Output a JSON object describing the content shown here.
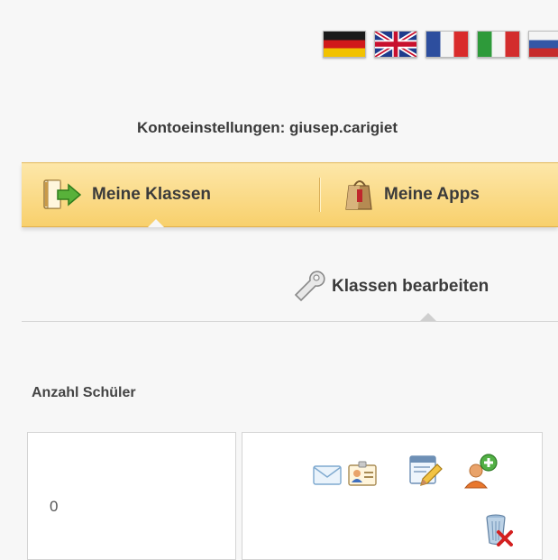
{
  "languages": [
    {
      "code": "de",
      "icon": "flag-germany-icon"
    },
    {
      "code": "en",
      "icon": "flag-uk-icon"
    },
    {
      "code": "fr",
      "icon": "flag-france-icon"
    },
    {
      "code": "it",
      "icon": "flag-italy-icon"
    },
    {
      "code": "ru",
      "icon": "flag-russia-icon"
    }
  ],
  "header": {
    "account_label": "Kontoeinstellungen: giusep.carigiet"
  },
  "nav": {
    "items": [
      {
        "label": "Meine Klassen",
        "icon": "book-arrow-icon",
        "active": true
      },
      {
        "label": "Meine Apps",
        "icon": "shopping-bag-icon",
        "active": false
      }
    ]
  },
  "subnav": {
    "label": "Klassen bearbeiten",
    "icon": "wrench-icon"
  },
  "table": {
    "column_header": "Anzahl Schüler",
    "rows": [
      {
        "student_count": "0"
      }
    ]
  },
  "actions": {
    "icons": [
      "envelope-icon",
      "id-card-icon",
      "edit-form-icon",
      "add-user-icon",
      "delete-icon"
    ]
  },
  "colors": {
    "nav_top": "#fde7a9",
    "nav_bottom": "#f8d06c",
    "background": "#f7f7f7"
  }
}
